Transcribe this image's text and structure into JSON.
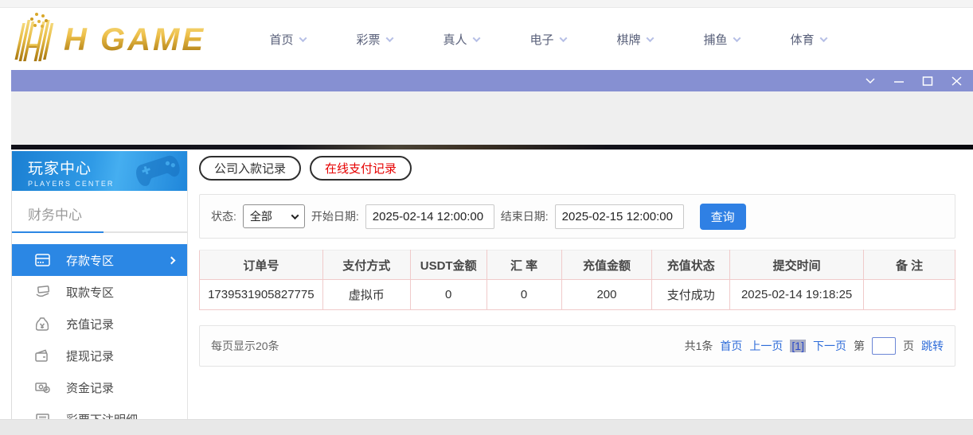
{
  "header": {
    "logo_text": "H GAME",
    "nav": [
      {
        "label": "首页"
      },
      {
        "label": "彩票"
      },
      {
        "label": "真人"
      },
      {
        "label": "电子"
      },
      {
        "label": "棋牌"
      },
      {
        "label": "捕鱼"
      },
      {
        "label": "体育"
      }
    ]
  },
  "titlebar": {
    "controls": [
      "chevron-down-icon",
      "minimize-icon",
      "maximize-icon",
      "close-icon"
    ]
  },
  "sidebar": {
    "title": "玩家中心",
    "subtitle": "PLAYERS CENTER",
    "section": "财务中心",
    "items": [
      {
        "label": "存款专区",
        "icon": "bank-card-icon",
        "active": true
      },
      {
        "label": "取款专区",
        "icon": "hand-card-icon",
        "active": false
      },
      {
        "label": "充值记录",
        "icon": "money-bag-icon",
        "active": false
      },
      {
        "label": "提现记录",
        "icon": "wallet-icon",
        "active": false
      },
      {
        "label": "资金记录",
        "icon": "banknote-coin-icon",
        "active": false
      },
      {
        "label": "彩票下注明细",
        "icon": "list-icon",
        "active": false
      }
    ]
  },
  "main": {
    "tabs": [
      {
        "label": "公司入款记录",
        "active": false
      },
      {
        "label": "在线支付记录",
        "active": true
      }
    ],
    "filters": {
      "status_label": "状态:",
      "status_value": "全部",
      "start_label": "开始日期:",
      "start_value": "2025-02-14 12:00:00",
      "end_label": "结束日期:",
      "end_value": "2025-02-15 12:00:00",
      "search_label": "查询"
    },
    "table": {
      "headers": [
        "订单号",
        "支付方式",
        "USDT金额",
        "汇 率",
        "充值金额",
        "充值状态",
        "提交时间",
        "备 注"
      ],
      "rows": [
        [
          "1739531905827775",
          "虚拟币",
          "0",
          "0",
          "200",
          "支付成功",
          "2025-02-14 19:18:25",
          ""
        ]
      ]
    },
    "pagination": {
      "page_size_text": "每页显示20条",
      "total_text": "共1条",
      "first": "首页",
      "prev": "上一页",
      "current": "[1]",
      "next": "下一页",
      "jump_pre": "第",
      "jump_post": "页",
      "jump_action": "跳转",
      "jump_value": ""
    }
  },
  "colors": {
    "accent_blue": "#2b87e4",
    "button_blue": "#2f80e4",
    "link_blue": "#2e6cd9",
    "titlebar_purple": "#8690d2",
    "tab_red": "#e60000",
    "logo_gold": "#d9a82a",
    "table_border_pink": "#f0caca",
    "sidebar_header_blue": "#2f9ae6"
  }
}
